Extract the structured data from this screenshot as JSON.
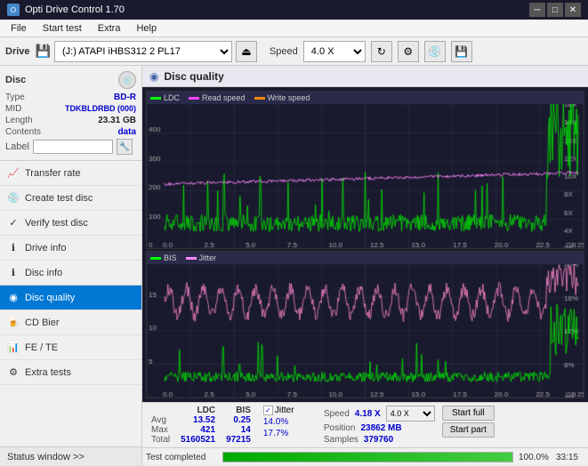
{
  "titlebar": {
    "title": "Opti Drive Control 1.70",
    "icon": "O",
    "minimize": "─",
    "maximize": "□",
    "close": "✕"
  },
  "menubar": {
    "items": [
      "File",
      "Start test",
      "Extra",
      "Help"
    ]
  },
  "toolbar": {
    "drive_label": "Drive",
    "drive_value": "(J:)  ATAPI iHBS312  2 PL17",
    "speed_label": "Speed",
    "speed_value": "4.0 X"
  },
  "disc": {
    "title": "Disc",
    "type_label": "Type",
    "type_value": "BD-R",
    "mid_label": "MID",
    "mid_value": "TDKBLDRBD (000)",
    "length_label": "Length",
    "length_value": "23.31 GB",
    "contents_label": "Contents",
    "contents_value": "data",
    "label_label": "Label",
    "label_value": ""
  },
  "nav": {
    "items": [
      {
        "id": "transfer-rate",
        "label": "Transfer rate",
        "icon": "📈"
      },
      {
        "id": "create-test-disc",
        "label": "Create test disc",
        "icon": "💿"
      },
      {
        "id": "verify-test-disc",
        "label": "Verify test disc",
        "icon": "✓"
      },
      {
        "id": "drive-info",
        "label": "Drive info",
        "icon": "ℹ"
      },
      {
        "id": "disc-info",
        "label": "Disc info",
        "icon": "ℹ"
      },
      {
        "id": "disc-quality",
        "label": "Disc quality",
        "icon": "◉",
        "active": true
      },
      {
        "id": "cd-bier",
        "label": "CD Bier",
        "icon": "🍺"
      },
      {
        "id": "fe-te",
        "label": "FE / TE",
        "icon": "📊"
      },
      {
        "id": "extra-tests",
        "label": "Extra tests",
        "icon": "⚙"
      }
    ]
  },
  "status_window": {
    "label": "Status window >>",
    "status_text": "Test completed"
  },
  "content": {
    "title": "Disc quality",
    "legend1": {
      "ldc_label": "LDC",
      "read_label": "Read speed",
      "write_label": "Write speed"
    },
    "legend2": {
      "bis_label": "BIS",
      "jitter_label": "Jitter"
    }
  },
  "stats": {
    "headers": [
      "LDC",
      "BIS"
    ],
    "avg_label": "Avg",
    "avg_ldc": "13.52",
    "avg_bis": "0.25",
    "max_label": "Max",
    "max_ldc": "421",
    "max_bis": "14",
    "total_label": "Total",
    "total_ldc": "5160521",
    "total_bis": "97215",
    "jitter_label": "Jitter",
    "jitter_checked": true,
    "jitter_avg": "14.0%",
    "jitter_max": "17.7%",
    "speed_label": "Speed",
    "speed_val": "4.18 X",
    "speed_select": "4.0 X",
    "position_label": "Position",
    "position_val": "23862 MB",
    "samples_label": "Samples",
    "samples_val": "379760",
    "start_full_label": "Start full",
    "start_part_label": "Start part",
    "progress_pct": 100,
    "progress_text": "100.0%",
    "time_text": "33:15"
  }
}
